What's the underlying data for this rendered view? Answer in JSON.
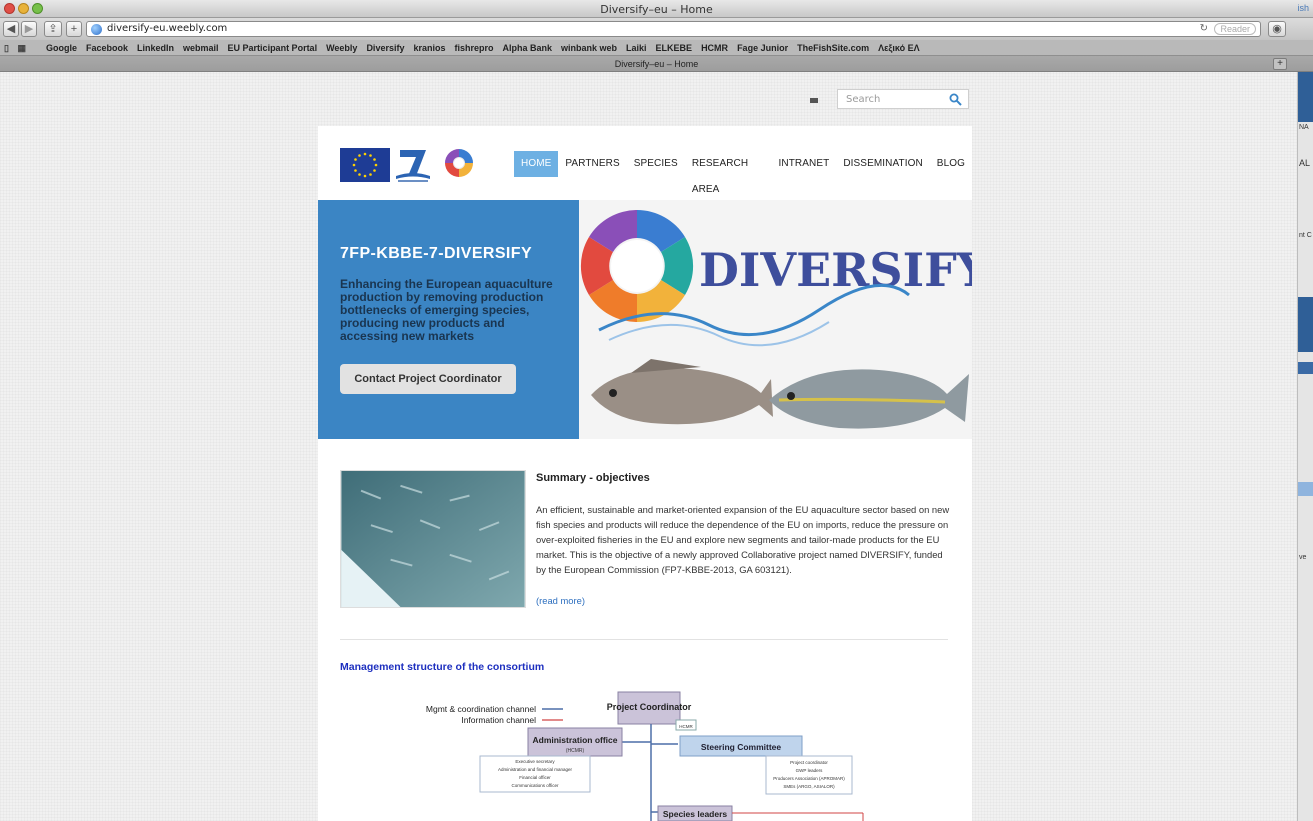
{
  "browser": {
    "window_title": "Diversify–eu – Home",
    "corner_text": "ish",
    "url": "diversify-eu.weebly.com",
    "reader_label": "Reader",
    "tab_title": "Diversify–eu – Home",
    "bookmarks": [
      "Google",
      "Facebook",
      "LinkedIn",
      "webmail",
      "EU Participant Portal",
      "Weebly",
      "Diversify",
      "kranios",
      "fishrepro",
      "Alpha Bank",
      "winbank web",
      "Laiki",
      "ELKEBE",
      "HCMR",
      "Fage Junior",
      "TheFishSite.com",
      "Λεξικό ΕΛ"
    ],
    "side_labels": [
      "NA",
      "AL",
      "nt C",
      "ve"
    ]
  },
  "search": {
    "placeholder": "Search"
  },
  "nav": {
    "items": [
      "HOME",
      "PARTNERS",
      "SPECIES",
      "RESEARCH AREA",
      "INTRANET",
      "DISSEMINATION",
      "BLOG"
    ],
    "active": "HOME"
  },
  "hero": {
    "title": "7FP-KBBE-7-DIVERSIFY",
    "subtitle": "Enhancing the European aquaculture production by removing production bottlenecks of emerging species, producing new products and accessing new markets",
    "button_label": "Contact Project Coordinator",
    "brand_text": "DIVERSIFY"
  },
  "summary": {
    "title": "Summary - objectives",
    "text": "An efficient, sustainable and market-oriented expansion of the EU aquaculture sector based on new fish species and products will reduce the dependence of the EU on imports, reduce the pressure on over-exploited fisheries in the EU and explore new segments and tailor-made products for the EU market.  This is the objective of a newly approved Collaborative project named DIVERSIFY, funded by the European Commission (FP7-KBBE-2013, GA 603121).",
    "read_more": "(read more)"
  },
  "management": {
    "title": "Management structure of the consortium",
    "legend_mgmt": "Mgmt & coordination channel",
    "legend_info": "Information channel",
    "coordinator": "Project Coordinator",
    "coordinator_tag": "HCMR",
    "admin_title": "Administration office",
    "admin_sub": "(HCMR)",
    "admin_items": [
      "Executive secretary",
      "Administration and financial manager",
      "Financial officer",
      "Communications officer"
    ],
    "steering": "Steering Committee",
    "steering_items": [
      "Project coordinator",
      "GWP leaders",
      "Producers Association (APROMAR)",
      "SMEs (ARGO, ASIALOR)"
    ],
    "species_leaders": "Species leaders"
  },
  "colors": {
    "hero_blue": "#3b85c4",
    "nav_active": "#6db0e3",
    "link": "#2d6fbf",
    "mgmt_title": "#1d2fbf"
  }
}
